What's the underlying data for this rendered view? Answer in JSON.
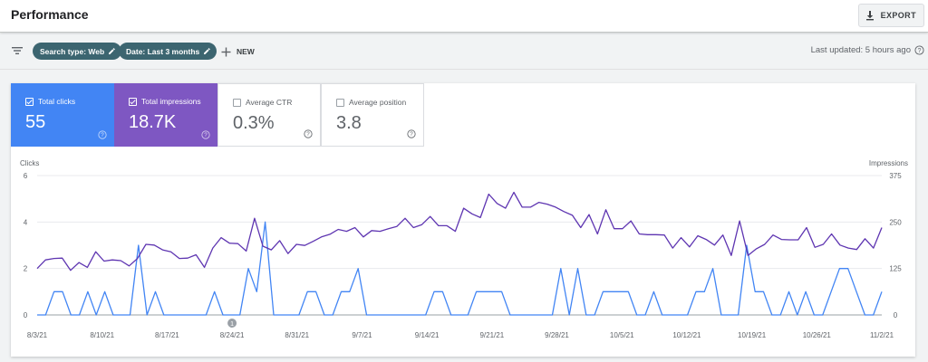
{
  "header": {
    "title": "Performance",
    "export_label": "EXPORT"
  },
  "filters": {
    "chips": [
      "Search type: Web",
      "Date: Last 3 months"
    ],
    "new_label": "NEW",
    "last_updated": "Last updated: 5 hours ago"
  },
  "metrics": [
    {
      "label": "Total clicks",
      "value": "55",
      "selected": true,
      "color": "#4285f4"
    },
    {
      "label": "Total impressions",
      "value": "18.7K",
      "selected": true,
      "color": "#7e57c2"
    },
    {
      "label": "Average CTR",
      "value": "0.3%",
      "selected": false,
      "color": "#ffffff"
    },
    {
      "label": "Average position",
      "value": "3.8",
      "selected": false,
      "color": "#ffffff"
    }
  ],
  "chart_data": {
    "type": "line",
    "left_axis_label": "Clicks",
    "right_axis_label": "Impressions",
    "left_ticks": [
      "6",
      "4",
      "2",
      "0"
    ],
    "right_ticks": [
      "375",
      "250",
      "125",
      "0"
    ],
    "ylim_left": [
      0,
      6
    ],
    "ylim_right": [
      0,
      375
    ],
    "x_ticks": [
      "8/3/21",
      "8/10/21",
      "8/17/21",
      "8/24/21",
      "8/31/21",
      "9/7/21",
      "9/14/21",
      "9/21/21",
      "9/28/21",
      "10/5/21",
      "10/12/21",
      "10/19/21",
      "10/26/21",
      "11/2/21"
    ],
    "annotation": {
      "label": "1",
      "date": "8/24/21"
    },
    "series": [
      {
        "name": "Total clicks",
        "axis": "left",
        "color": "#4285f4",
        "values": [
          0,
          0,
          1,
          1,
          0,
          0,
          1,
          0,
          1,
          0,
          0,
          0,
          3,
          0,
          1,
          0,
          0,
          0,
          0,
          0,
          0,
          1,
          0,
          0,
          0,
          2,
          1,
          4,
          0,
          0,
          0,
          0,
          1,
          1,
          0,
          0,
          1,
          1,
          2,
          0,
          0,
          0,
          0,
          0,
          0,
          0,
          0,
          1,
          1,
          0,
          0,
          0,
          1,
          1,
          1,
          1,
          0,
          0,
          0,
          0,
          0,
          0,
          2,
          0,
          2,
          0,
          0,
          1,
          1,
          1,
          1,
          0,
          0,
          1,
          0,
          0,
          0,
          0,
          1,
          1,
          2,
          0,
          0,
          0,
          3,
          1,
          1,
          0,
          0,
          1,
          0,
          1,
          0,
          0,
          1,
          2,
          2,
          1,
          0,
          0,
          1
        ]
      },
      {
        "name": "Total impressions",
        "axis": "right",
        "color": "#5e35b1",
        "values": [
          125,
          148,
          152,
          153,
          120,
          141,
          128,
          170,
          145,
          148,
          146,
          132,
          152,
          190,
          188,
          175,
          170,
          152,
          153,
          162,
          128,
          180,
          208,
          193,
          192,
          172,
          260,
          185,
          175,
          200,
          165,
          190,
          187,
          198,
          210,
          217,
          230,
          225,
          235,
          210,
          227,
          225,
          232,
          238,
          260,
          235,
          243,
          265,
          240,
          240,
          225,
          287,
          272,
          262,
          325,
          300,
          287,
          330,
          290,
          290,
          303,
          298,
          290,
          278,
          268,
          235,
          270,
          218,
          283,
          232,
          232,
          253,
          218,
          216,
          216,
          215,
          180,
          208,
          183,
          213,
          203,
          188,
          215,
          160,
          253,
          160,
          178,
          190,
          215,
          203,
          202,
          202,
          235,
          182,
          190,
          218,
          188,
          180,
          176,
          205,
          180,
          235
        ]
      }
    ]
  }
}
